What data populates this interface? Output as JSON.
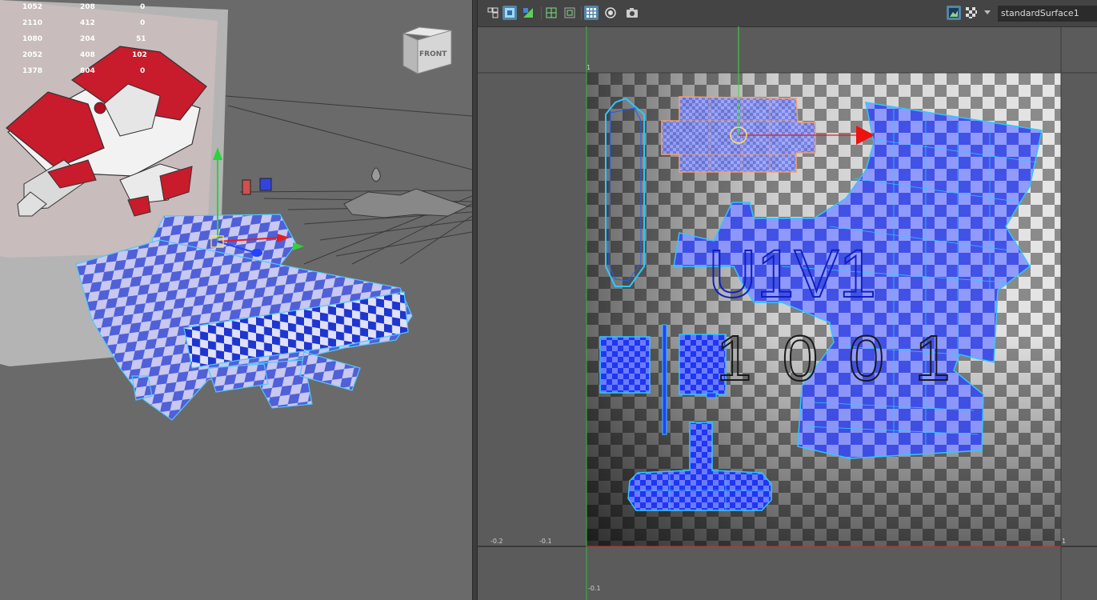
{
  "hud": {
    "rows": [
      [
        "1052",
        "208",
        "0"
      ],
      [
        "2110",
        "412",
        "0"
      ],
      [
        "1080",
        "204",
        "51"
      ],
      [
        "2052",
        "408",
        "102"
      ],
      [
        "1378",
        "804",
        "0"
      ]
    ]
  },
  "view_cube": {
    "label": "FRONT"
  },
  "uv_editor": {
    "toolbar": {
      "material": "standardSurface1",
      "icons": [
        "uv-shell-icon",
        "uv-select-icon",
        "uv-shade-icon",
        "grid-icon",
        "grid-snap-icon",
        "checker-grid-icon",
        "isolate-icon",
        "snapshot-icon",
        "image-display-icon",
        "checker-map-icon",
        "dropdown-arrow-icon"
      ]
    },
    "udim": {
      "label": "U1V1",
      "tile_number": "1 0 0 1"
    },
    "axis_labels": {
      "v_top": "1",
      "u_neg_02": "-0.2",
      "u_neg_01": "-0.1",
      "u_one": "1",
      "v_neg_01": "-0.1"
    }
  },
  "colors": {
    "uv_shell": "#2a3cff",
    "uv_edge": "#2fc7ff",
    "selected_shell": "#f0a070",
    "viewport_bg": "#6a6a6a",
    "editor_bg": "#5b5b5b",
    "toolbar_active": "#5285a6"
  }
}
